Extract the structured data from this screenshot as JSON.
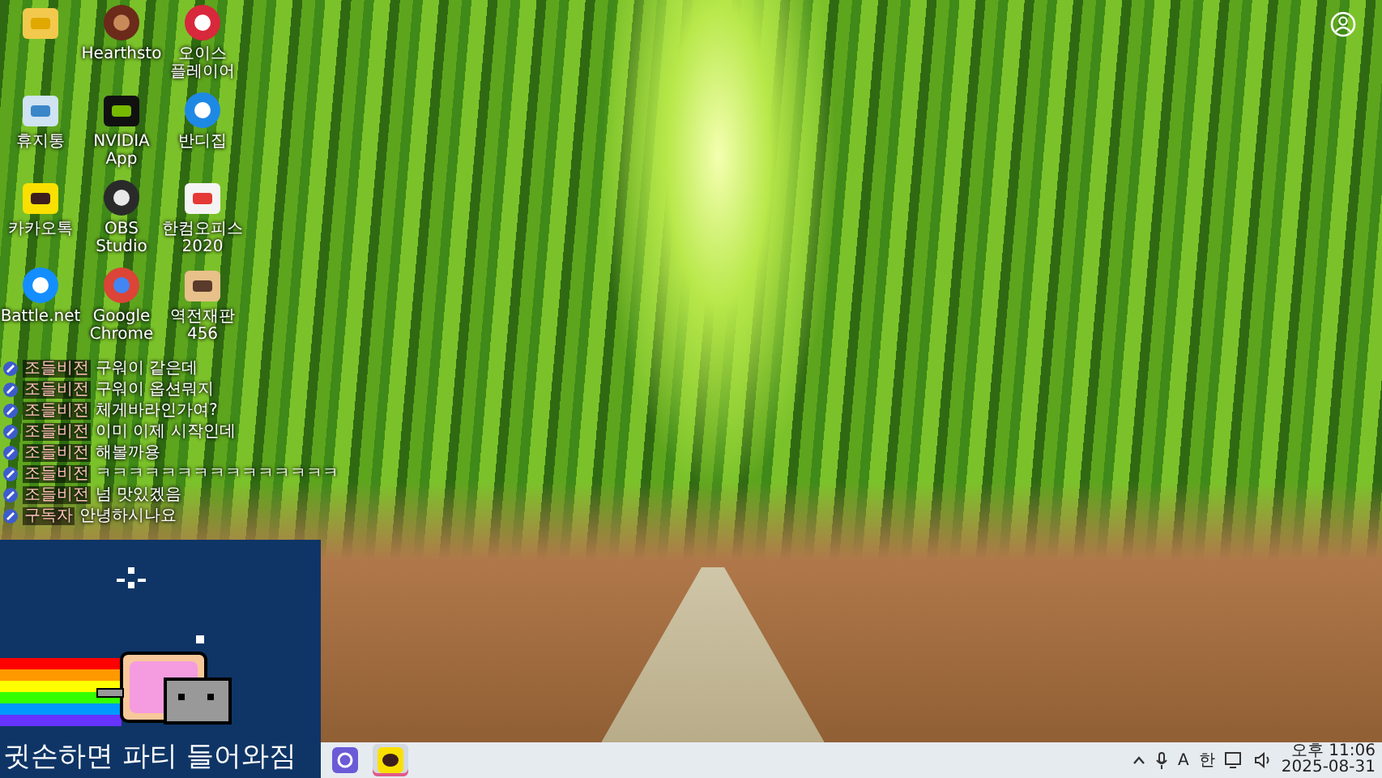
{
  "desktop_icons": [
    {
      "kind": "folder"
    },
    {
      "kind": "avatar",
      "label": "Hearthsto"
    },
    {
      "kind": "red-app",
      "label": "오이스 플레이어"
    },
    {
      "kind": "recycle",
      "label": "휴지통"
    },
    {
      "kind": "nvidia",
      "label": "NVIDIA App"
    },
    {
      "kind": "bolt",
      "label": "반디집"
    },
    {
      "kind": "talk",
      "label": "카카오톡"
    },
    {
      "kind": "obs",
      "label": "OBS Studio"
    },
    {
      "kind": "office",
      "label": "한컴오피스 2020"
    },
    {
      "kind": "battle",
      "label": "Battle.net"
    },
    {
      "kind": "chrome",
      "label": "Google Chrome"
    },
    {
      "kind": "game",
      "label": "역전재판 456"
    }
  ],
  "chat": [
    {
      "name": "조들비전",
      "message": "구워이 같은데"
    },
    {
      "name": "조들비전",
      "message": "구워이 옵션뭐지"
    },
    {
      "name": "조들비전",
      "message": "체게바라인가여?"
    },
    {
      "name": "조들비전",
      "message": "이미 이제 시작인데"
    },
    {
      "name": "조들비전",
      "message": "해볼까용"
    },
    {
      "name": "조들비전",
      "message": "ㅋㅋㅋㅋㅋㅋㅋㅋㅋㅋㅋㅋㅋㅋㅋ"
    },
    {
      "name": "조들비전",
      "message": "넘 맛있겠음"
    },
    {
      "name": "구독자",
      "message": "안녕하시나요"
    }
  ],
  "overlay": {
    "caption": "귓손하면 파티 들어와짐"
  },
  "taskbar": {
    "apps": [
      {
        "kind": "purple",
        "active": false
      },
      {
        "kind": "kakao",
        "active": true
      }
    ],
    "ime_mode": "A",
    "ime_lang": "한",
    "time": "오후 11:06",
    "date": "2025-08-31"
  }
}
